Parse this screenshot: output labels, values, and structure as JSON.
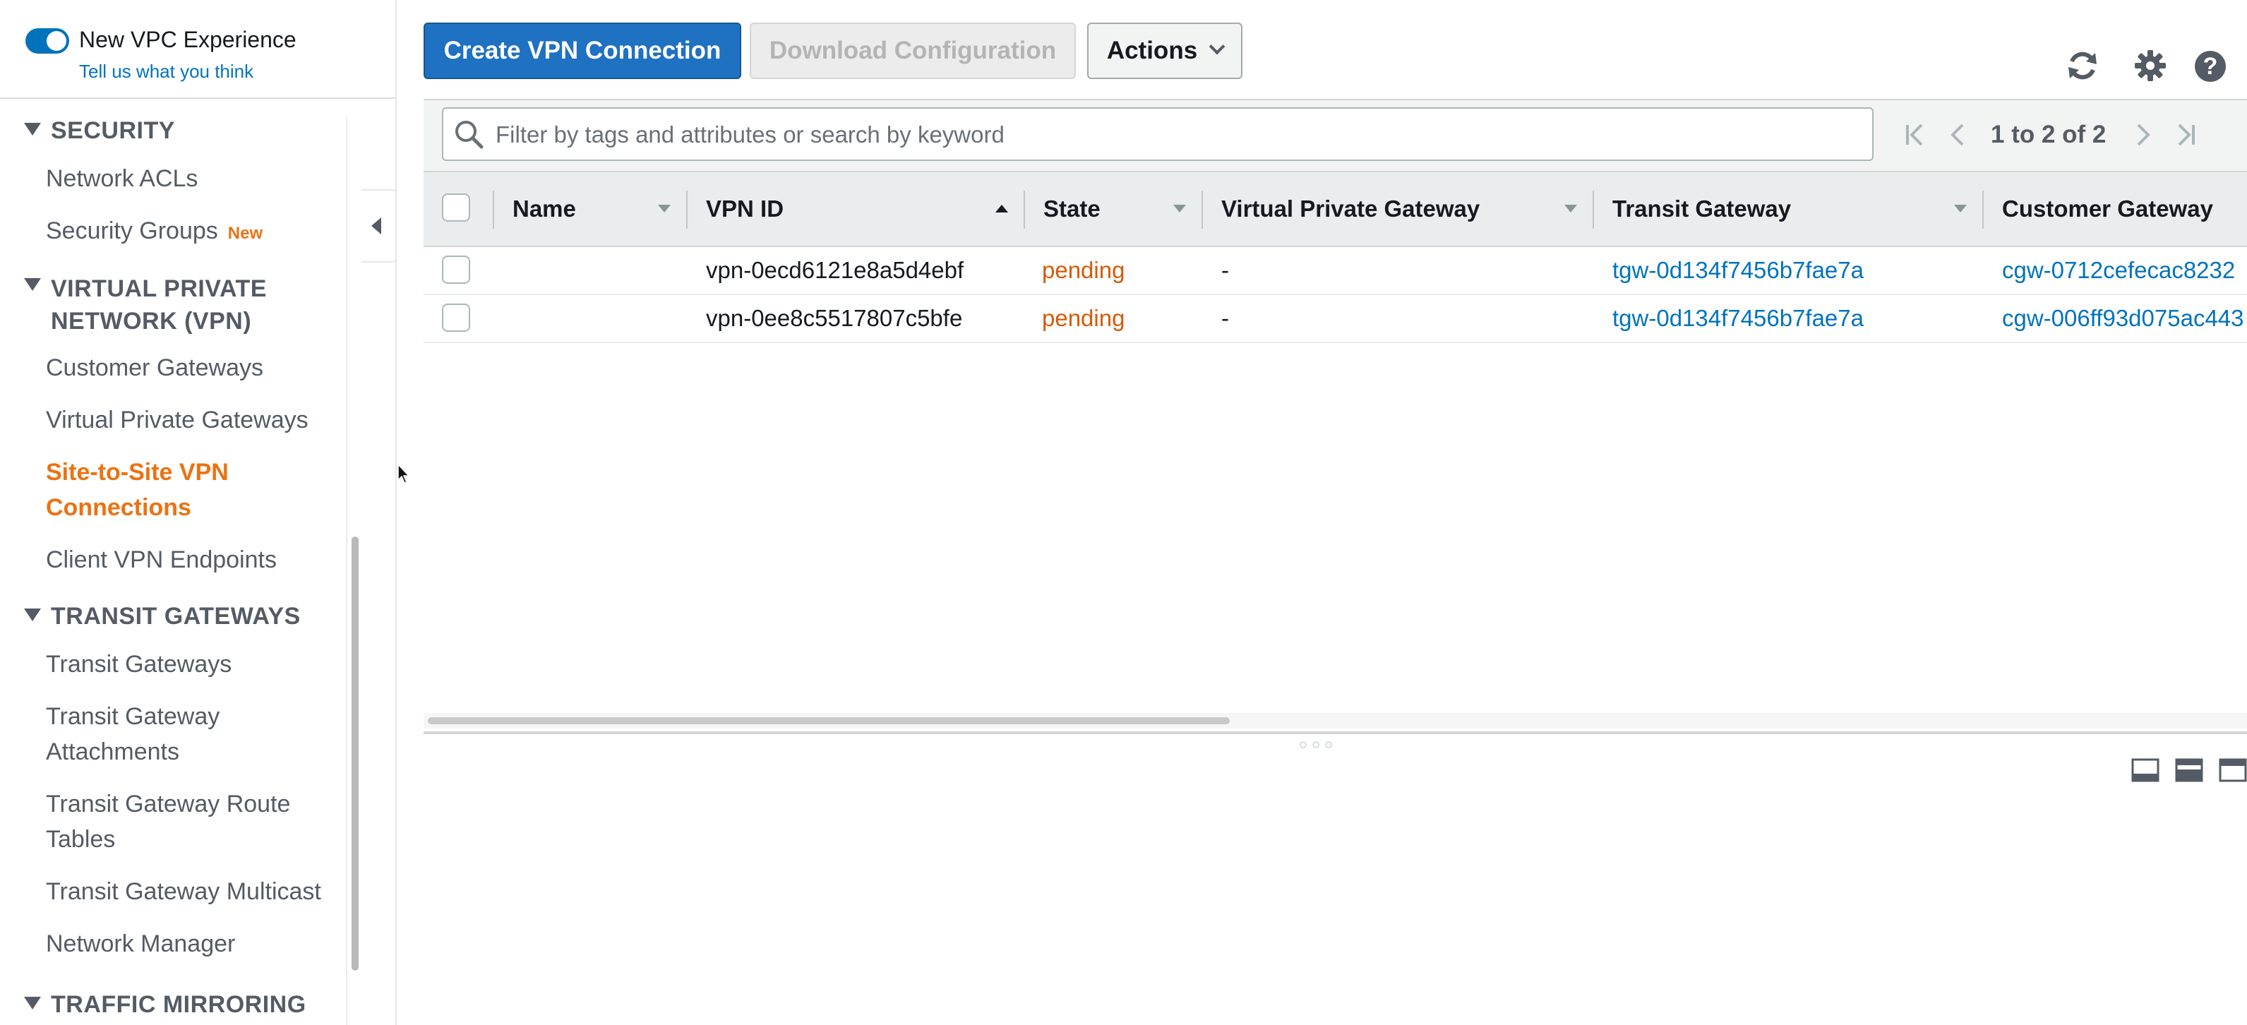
{
  "sidebar": {
    "vpc_experience": {
      "title": "New VPC Experience",
      "link": "Tell us what you think",
      "toggle_on": true
    },
    "sections": {
      "security": {
        "label": "SECURITY",
        "items": [
          {
            "label": "Network ACLs"
          },
          {
            "label": "Security Groups",
            "badge": "New"
          }
        ]
      },
      "vpn": {
        "label_line1": "VIRTUAL PRIVATE",
        "label_line2": "NETWORK (VPN)",
        "items": [
          {
            "label": "Customer Gateways"
          },
          {
            "label": "Virtual Private Gateways"
          },
          {
            "label_line1": "Site-to-Site VPN",
            "label_line2": "Connections",
            "active": true
          },
          {
            "label": "Client VPN Endpoints"
          }
        ]
      },
      "transit": {
        "label": "TRANSIT GATEWAYS",
        "items": [
          {
            "label": "Transit Gateways"
          },
          {
            "label_line1": "Transit Gateway",
            "label_line2": "Attachments"
          },
          {
            "label_line1": "Transit Gateway Route",
            "label_line2": "Tables"
          },
          {
            "label": "Transit Gateway Multicast"
          },
          {
            "label": "Network Manager"
          }
        ]
      },
      "traffic": {
        "label": "TRAFFIC MIRRORING"
      }
    }
  },
  "toolbar": {
    "create_label": "Create VPN Connection",
    "download_label": "Download Configuration",
    "actions_label": "Actions"
  },
  "icons": {
    "refresh": "refresh-icon",
    "settings": "gear-icon",
    "help": "help-icon",
    "help_glyph": "?"
  },
  "search": {
    "placeholder": "Filter by tags and attributes or search by keyword",
    "value": ""
  },
  "pagination": {
    "text": "1 to 2 of 2"
  },
  "table": {
    "columns": [
      "Name",
      "VPN ID",
      "State",
      "Virtual Private Gateway",
      "Transit Gateway",
      "Customer Gateway"
    ],
    "sorted_column": "VPN ID",
    "rows": [
      {
        "name": "",
        "vpn_id": "vpn-0ecd6121e8a5d4ebf",
        "state": "pending",
        "vgw": "-",
        "tgw": "tgw-0d134f7456b7fae7a",
        "cgw": "cgw-0712cefecac8232"
      },
      {
        "name": "",
        "vpn_id": "vpn-0ee8c5517807c5bfe",
        "state": "pending",
        "vgw": "-",
        "tgw": "tgw-0d134f7456b7fae7a",
        "cgw": "cgw-006ff93d075ac443"
      }
    ]
  },
  "colors": {
    "accent": "#1f71c1",
    "active_nav": "#ec7211",
    "pending": "#d45b07",
    "link": "#0073bb"
  }
}
